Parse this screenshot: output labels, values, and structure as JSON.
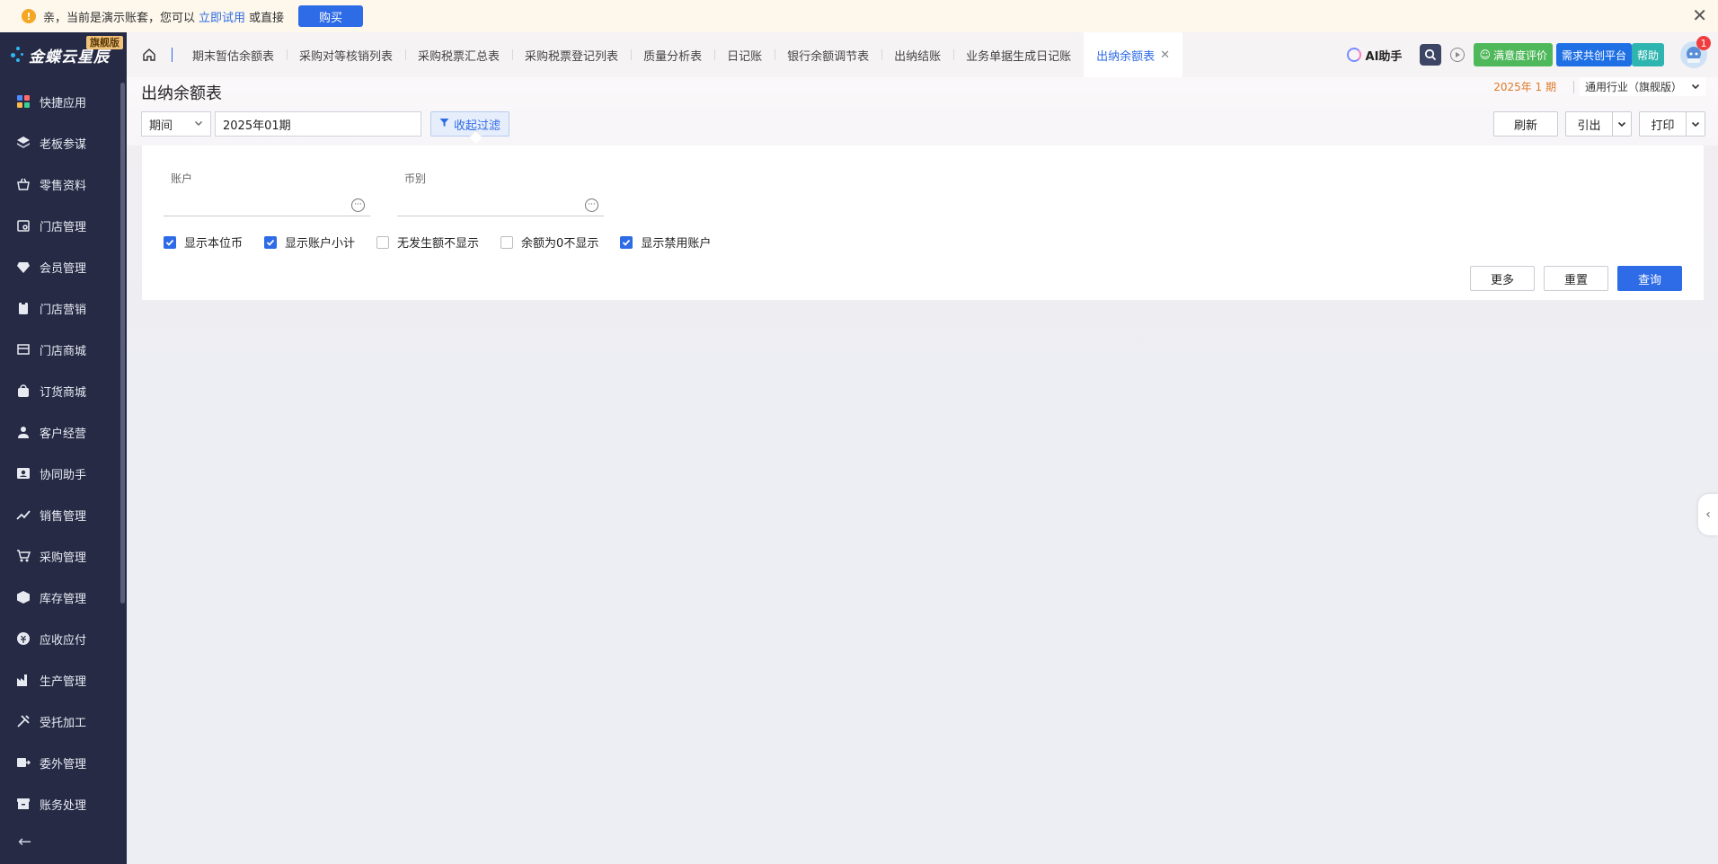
{
  "notice": {
    "text_prefix": "亲，当前是演示账套，您可以",
    "try_link": "立即试用",
    "text_suffix": "或直接",
    "buy_label": "购买"
  },
  "brand": {
    "name": "金蝶云星辰",
    "edition_badge": "旗舰版"
  },
  "sidebar": {
    "items": [
      {
        "label": "快捷应用",
        "icon": "grid-icon"
      },
      {
        "label": "老板参谋",
        "icon": "layers-icon"
      },
      {
        "label": "零售资料",
        "icon": "basket-icon"
      },
      {
        "label": "门店管理",
        "icon": "store-settings-icon"
      },
      {
        "label": "会员管理",
        "icon": "diamond-icon"
      },
      {
        "label": "门店营销",
        "icon": "clipboard-icon"
      },
      {
        "label": "门店商城",
        "icon": "shop-icon"
      },
      {
        "label": "订货商城",
        "icon": "bag-icon"
      },
      {
        "label": "客户经营",
        "icon": "user-icon"
      },
      {
        "label": "协同助手",
        "icon": "contact-icon"
      },
      {
        "label": "销售管理",
        "icon": "trend-icon"
      },
      {
        "label": "采购管理",
        "icon": "cart-icon"
      },
      {
        "label": "库存管理",
        "icon": "box-icon"
      },
      {
        "label": "应收应付",
        "icon": "coin-icon"
      },
      {
        "label": "生产管理",
        "icon": "factory-icon"
      },
      {
        "label": "受托加工",
        "icon": "tools-icon"
      },
      {
        "label": "委外管理",
        "icon": "outsource-icon"
      },
      {
        "label": "账务处理",
        "icon": "archive-icon"
      }
    ]
  },
  "tabs": [
    {
      "label": "期末暂估余额表",
      "active": false
    },
    {
      "label": "采购对等核销列表",
      "active": false
    },
    {
      "label": "采购税票汇总表",
      "active": false
    },
    {
      "label": "采购税票登记列表",
      "active": false
    },
    {
      "label": "质量分析表",
      "active": false
    },
    {
      "label": "日记账",
      "active": false
    },
    {
      "label": "银行余额调节表",
      "active": false
    },
    {
      "label": "出纳结账",
      "active": false
    },
    {
      "label": "业务单据生成日记账",
      "active": false
    },
    {
      "label": "出纳余额表",
      "active": true
    }
  ],
  "toolbar": {
    "ai_label": "AI助手",
    "satisfaction_label": "满意度评价",
    "demand_label": "需求共创平台",
    "help_label": "帮助",
    "notification_count": "1"
  },
  "page": {
    "title": "出纳余额表",
    "period_info": "2025年 1 期",
    "industry": "通用行业（旗舰版）",
    "period_type": "期间",
    "period_value": "2025年01期",
    "collapse_filter": "收起过滤",
    "refresh": "刷新",
    "export": "引出",
    "print": "打印"
  },
  "filters": {
    "account_label": "账户",
    "currency_label": "币别",
    "options": [
      {
        "label": "显示本位币",
        "checked": true
      },
      {
        "label": "显示账户小计",
        "checked": true
      },
      {
        "label": "无发生额不显示",
        "checked": false
      },
      {
        "label": "余额为0不显示",
        "checked": false
      },
      {
        "label": "显示禁用账户",
        "checked": true
      }
    ],
    "more": "更多",
    "reset": "重置",
    "query": "查询"
  },
  "colors": {
    "accent": "#2e6be6",
    "sidebar_bg": "#262a45",
    "period_info": "#e07b2a"
  }
}
